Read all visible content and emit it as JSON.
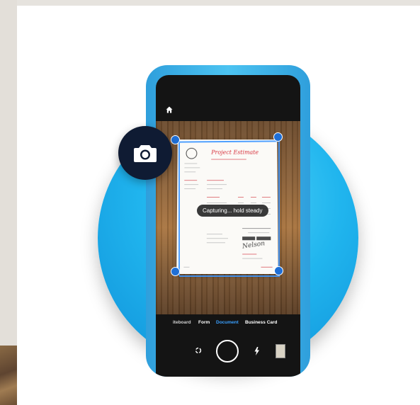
{
  "document": {
    "title": "Project Estimate",
    "signature": "Nelson"
  },
  "scanner": {
    "status_toast": "Capturing... hold steady",
    "modes": {
      "whiteboard_partial": "iteboard",
      "form": "Form",
      "document": "Document",
      "business_card": "Business Card"
    },
    "active_mode": "Document"
  },
  "icons": {
    "home": "home-icon",
    "camera_badge": "camera-icon",
    "flash": "flash-auto-icon",
    "rotate": "rotate-icon"
  },
  "colors": {
    "accent": "#3aa0ff",
    "circle": "#20b5ee",
    "badge": "#0f1b33",
    "doc_title": "#d62f3a"
  }
}
